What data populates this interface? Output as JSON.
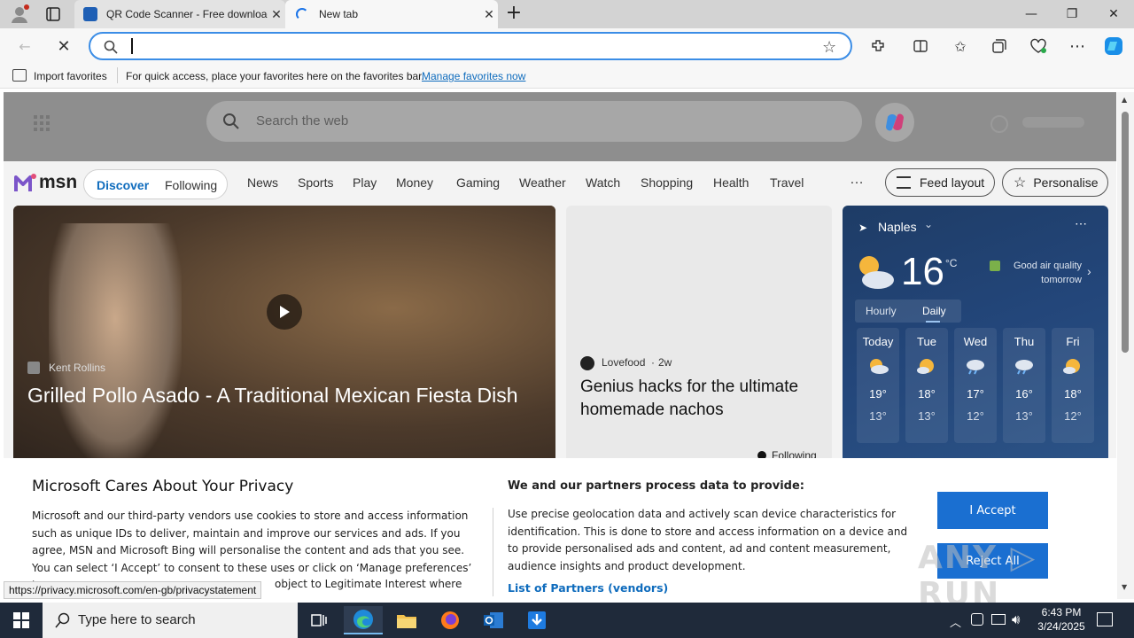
{
  "browser": {
    "tabs": [
      {
        "title": "QR Code Scanner - Free download"
      },
      {
        "title": "New tab"
      }
    ],
    "address_value": "",
    "favorites_bar": {
      "import_label": "Import favorites",
      "message": "For quick access, place your favorites here on the favorites bar.",
      "manage_link": "Manage favorites now"
    }
  },
  "newtab": {
    "search_placeholder": "Search the web",
    "nav": {
      "discover": "Discover",
      "following": "Following",
      "items": [
        "News",
        "Sports",
        "Play",
        "Money",
        "Gaming",
        "Weather",
        "Watch",
        "Shopping",
        "Health",
        "Travel"
      ],
      "more": "…",
      "feed_layout": "Feed layout",
      "personalise": "Personalise"
    },
    "logo": "msn",
    "hero": {
      "source": "Kent Rollins",
      "title": "Grilled Pollo Asado - A Traditional Mexican Fiesta Dish"
    },
    "card2": {
      "source": "Lovefood",
      "age": "2w",
      "title": "Genius hacks for the ultimate homemade nachos",
      "following": "Following"
    },
    "weather": {
      "location": "Naples",
      "temp": "16",
      "unit": "°C",
      "air_quality": "Good air quality tomorrow",
      "tab_hourly": "Hourly",
      "tab_daily": "Daily",
      "days": [
        {
          "day": "Today",
          "high": "19°",
          "low": "13°"
        },
        {
          "day": "Tue",
          "high": "18°",
          "low": "13°"
        },
        {
          "day": "Wed",
          "high": "17°",
          "low": "12°"
        },
        {
          "day": "Thu",
          "high": "16°",
          "low": "13°"
        },
        {
          "day": "Fri",
          "high": "18°",
          "low": "12°"
        }
      ]
    }
  },
  "privacy": {
    "title": "Microsoft Cares About Your Privacy",
    "body": "Microsoft and our third-party vendors use cookies to store and access information such as unique IDs to deliver, maintain and improve our services and ads. If you agree, MSN and Microsoft Bing will personalise the content and ads that you see. You can select ‘I Accept’ to consent to these uses or click on ‘Manage preferences’ to",
    "body_tail": "object to Legitimate Interest where",
    "partners_heading": "We and our partners process data to provide:",
    "partners_body": "Use precise geolocation data and actively scan device characteristics for identification. This is done to store and access information on a device and to provide personalised ads and content, ad and content measurement, audience insights and product development.",
    "partners_link": "List of Partners (vendors)",
    "accept": "I Accept",
    "reject": "Reject All"
  },
  "status_url": "https://privacy.microsoft.com/en-gb/privacystatement",
  "taskbar": {
    "search_placeholder": "Type here to search",
    "time": "6:43 PM",
    "date": "3/24/2025"
  },
  "colors": {
    "accent": "#0f6cbd",
    "accept_button": "#1a6fd1",
    "weather_bg": "#23467a"
  }
}
